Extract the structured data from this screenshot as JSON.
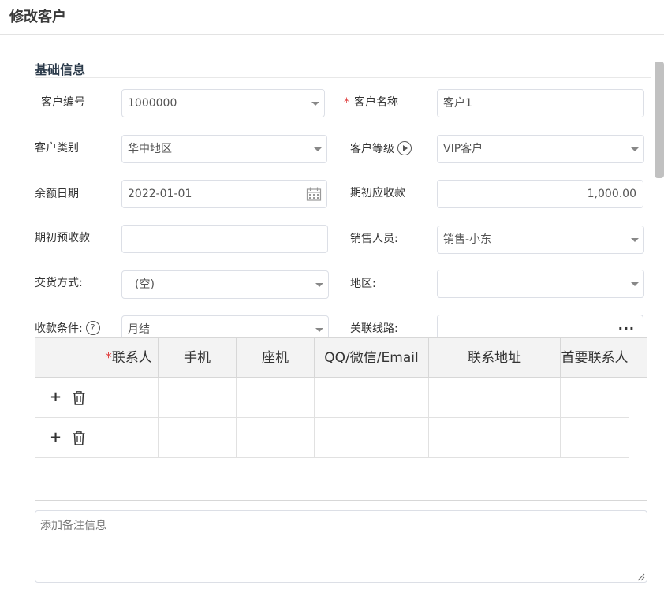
{
  "header": {
    "title": "修改客户"
  },
  "section": {
    "title": "基础信息"
  },
  "form": {
    "customer_code": {
      "label": "客户编号",
      "value": "1000000"
    },
    "customer_name": {
      "label": "客户名称",
      "required_mark": "*",
      "value": "客户1"
    },
    "customer_type": {
      "label": "客户类别",
      "value": "华中地区"
    },
    "customer_level": {
      "label": "客户等级",
      "value": "VIP客户"
    },
    "balance_date": {
      "label": "余额日期",
      "value": "2022-01-01"
    },
    "initial_receivable": {
      "label": "期初应收款",
      "value": "1,000.00"
    },
    "initial_prepaid": {
      "label": "期初预收款",
      "value": ""
    },
    "salesperson": {
      "label": "销售人员:",
      "value": "销售-小东"
    },
    "delivery_method": {
      "label": "交货方式:",
      "value": "(空)"
    },
    "region": {
      "label": "地区:",
      "value": ""
    },
    "payment_terms": {
      "label": "收款条件:",
      "value": "月结"
    },
    "route": {
      "label": "关联线路:",
      "value": "",
      "button": "···"
    },
    "help_glyph": "?"
  },
  "contacts": {
    "required_mark": "*",
    "columns": [
      "联系人",
      "手机",
      "座机",
      "QQ/微信/Email",
      "联系地址",
      "首要联系人"
    ],
    "rows": [
      {
        "add": "+",
        "cells": [
          "",
          "",
          "",
          "",
          "",
          ""
        ]
      },
      {
        "add": "+",
        "cells": [
          "",
          "",
          "",
          "",
          "",
          ""
        ]
      }
    ]
  },
  "remark": {
    "placeholder": "添加备注信息"
  }
}
